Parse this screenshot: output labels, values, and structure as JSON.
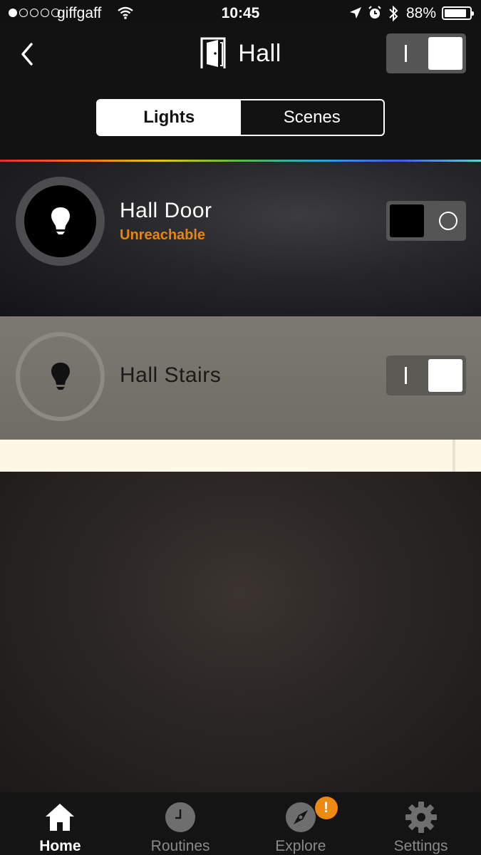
{
  "status_bar": {
    "carrier": "giffgaff",
    "time": "10:45",
    "battery": "88%",
    "battery_level": 0.88,
    "signal_bars_filled": 1,
    "signal_bars_total": 5
  },
  "header": {
    "title": "Hall",
    "room_icon": "door-icon",
    "group_toggle_on": true
  },
  "segments": {
    "lights_label": "Lights",
    "scenes_label": "Scenes",
    "selected": "Lights"
  },
  "lights": [
    {
      "name": "Hall Door",
      "status": "Unreachable",
      "on": false,
      "icon": "bulb-icon"
    },
    {
      "name": "Hall Stairs",
      "status": "",
      "on": true,
      "icon": "bulb-icon"
    }
  ],
  "colors": {
    "accent_warning": "#e8850e",
    "badge": "#ee8a12",
    "header_bg": "#121212",
    "stairs_row_bg": "#7b7971"
  },
  "tab_bar": {
    "tabs": [
      {
        "label": "Home",
        "icon": "home-icon",
        "active": true
      },
      {
        "label": "Routines",
        "icon": "clock-icon",
        "active": false
      },
      {
        "label": "Explore",
        "icon": "compass-icon",
        "active": false,
        "badge": "!"
      },
      {
        "label": "Settings",
        "icon": "gear-icon",
        "active": false
      }
    ]
  }
}
